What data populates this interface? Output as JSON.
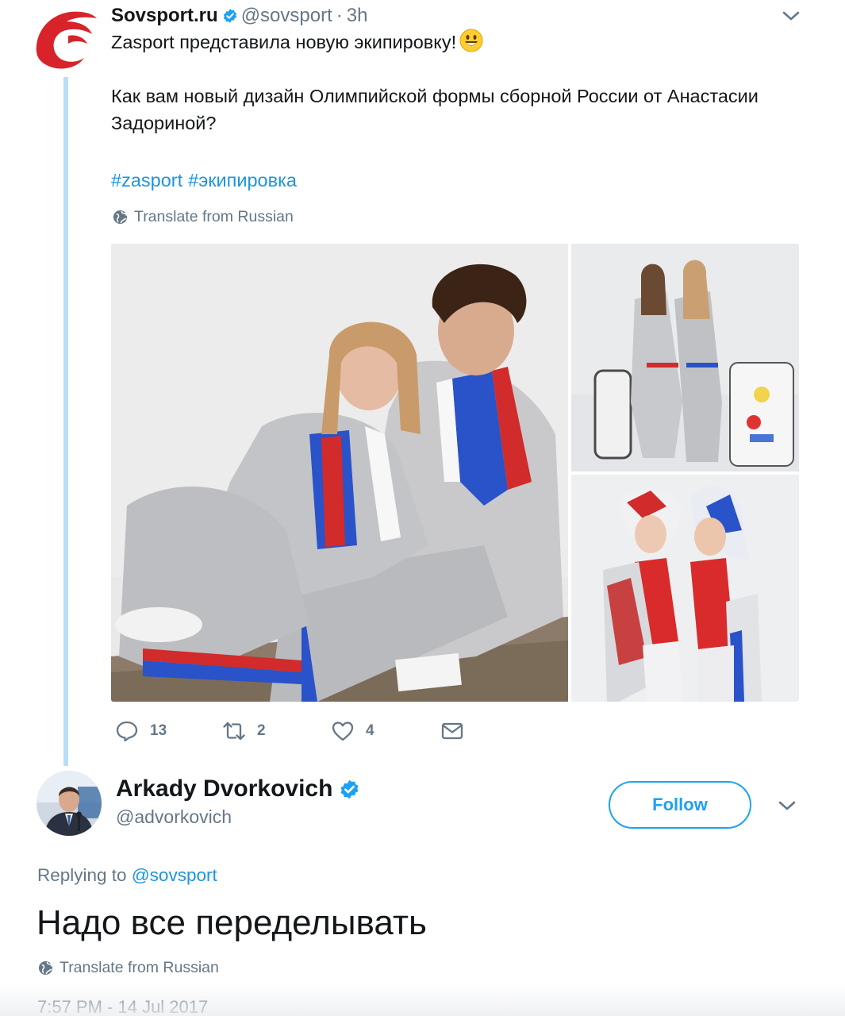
{
  "parent_tweet": {
    "author_name": "Sovsport.ru",
    "handle": "@sovsport",
    "separator": "·",
    "time": "3h",
    "text_line1": "Zasport представила новую экипировку!",
    "text_line2": "Как вам новый дизайн Олимпийской формы сборной России от Анастасии Задориной?",
    "hashtags": [
      "#zasport",
      "#экипировка"
    ],
    "translate_label": "Translate from Russian",
    "icons": {
      "avatar": "sovsport-logo",
      "verified": "verified-badge-icon",
      "emoji": "smiley-emoji",
      "menu": "chevron-down-icon",
      "translate": "globe-icon"
    },
    "actions": {
      "replies": "13",
      "retweets": "2",
      "likes": "4"
    }
  },
  "reply_tweet": {
    "author_name": "Arkady Dvorkovich",
    "handle": "@advorkovich",
    "follow_label": "Follow",
    "replying_prefix": "Replying to",
    "replying_to": "@sovsport",
    "text": "Надо все переделывать",
    "translate_label": "Translate from Russian",
    "timestamp": "7:57 PM - 14 Jul 2017"
  },
  "colors": {
    "accent": "#1da1f2",
    "link": "#1b95e0",
    "muted": "#657786",
    "thread_line": "#b8def7",
    "brand_red": "#d8232a"
  }
}
